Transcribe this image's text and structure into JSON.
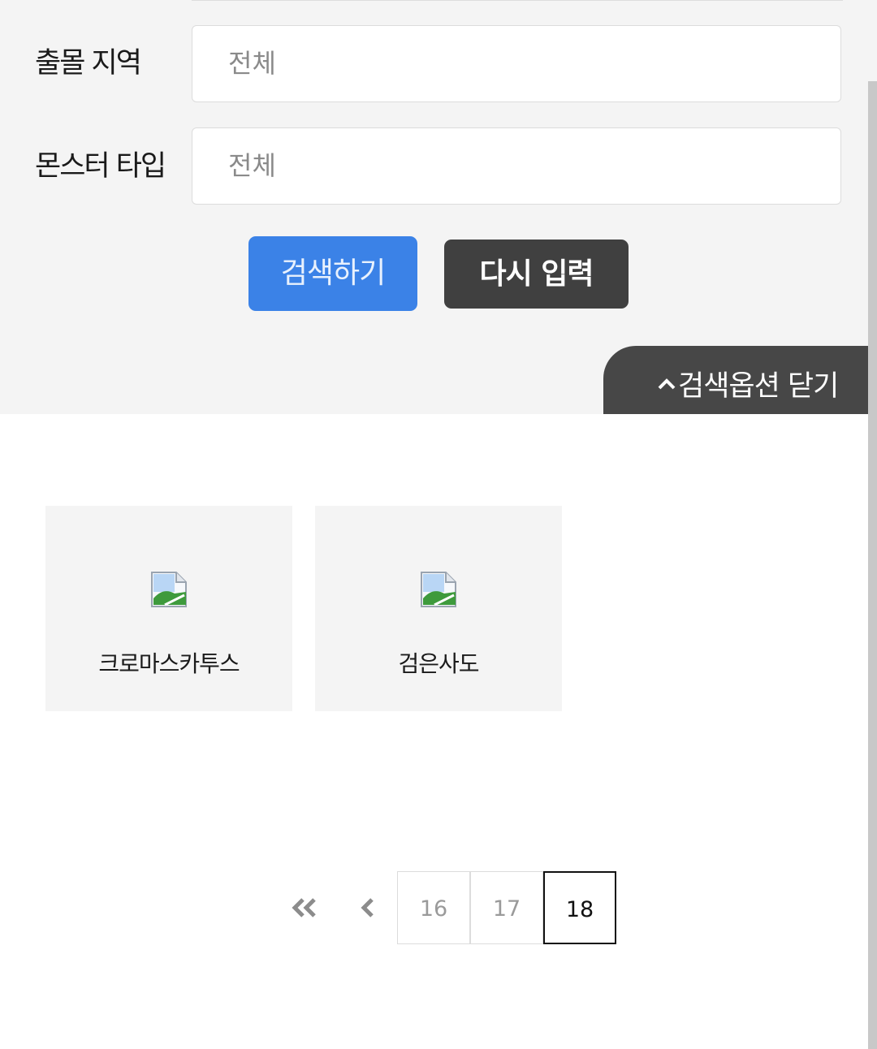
{
  "search_panel": {
    "region_label": "출몰 지역",
    "region_value": "전체",
    "type_label": "몬스터 타입",
    "type_value": "전체",
    "search_button": "검색하기",
    "reset_button": "다시 입력",
    "close_options": "검색옵션 닫기"
  },
  "results": [
    {
      "name": "크로마스카투스",
      "image": "broken-image-icon"
    },
    {
      "name": "검은사도",
      "image": "broken-image-icon"
    }
  ],
  "pagination": {
    "first_icon": "double-chevron-left-icon",
    "prev_icon": "chevron-left-icon",
    "pages": [
      "16",
      "17",
      "18"
    ],
    "current": "18"
  },
  "colors": {
    "panel_bg": "#f4f4f4",
    "search_button": "#3b82e7",
    "reset_button": "#404040",
    "close_tab": "#474747"
  }
}
